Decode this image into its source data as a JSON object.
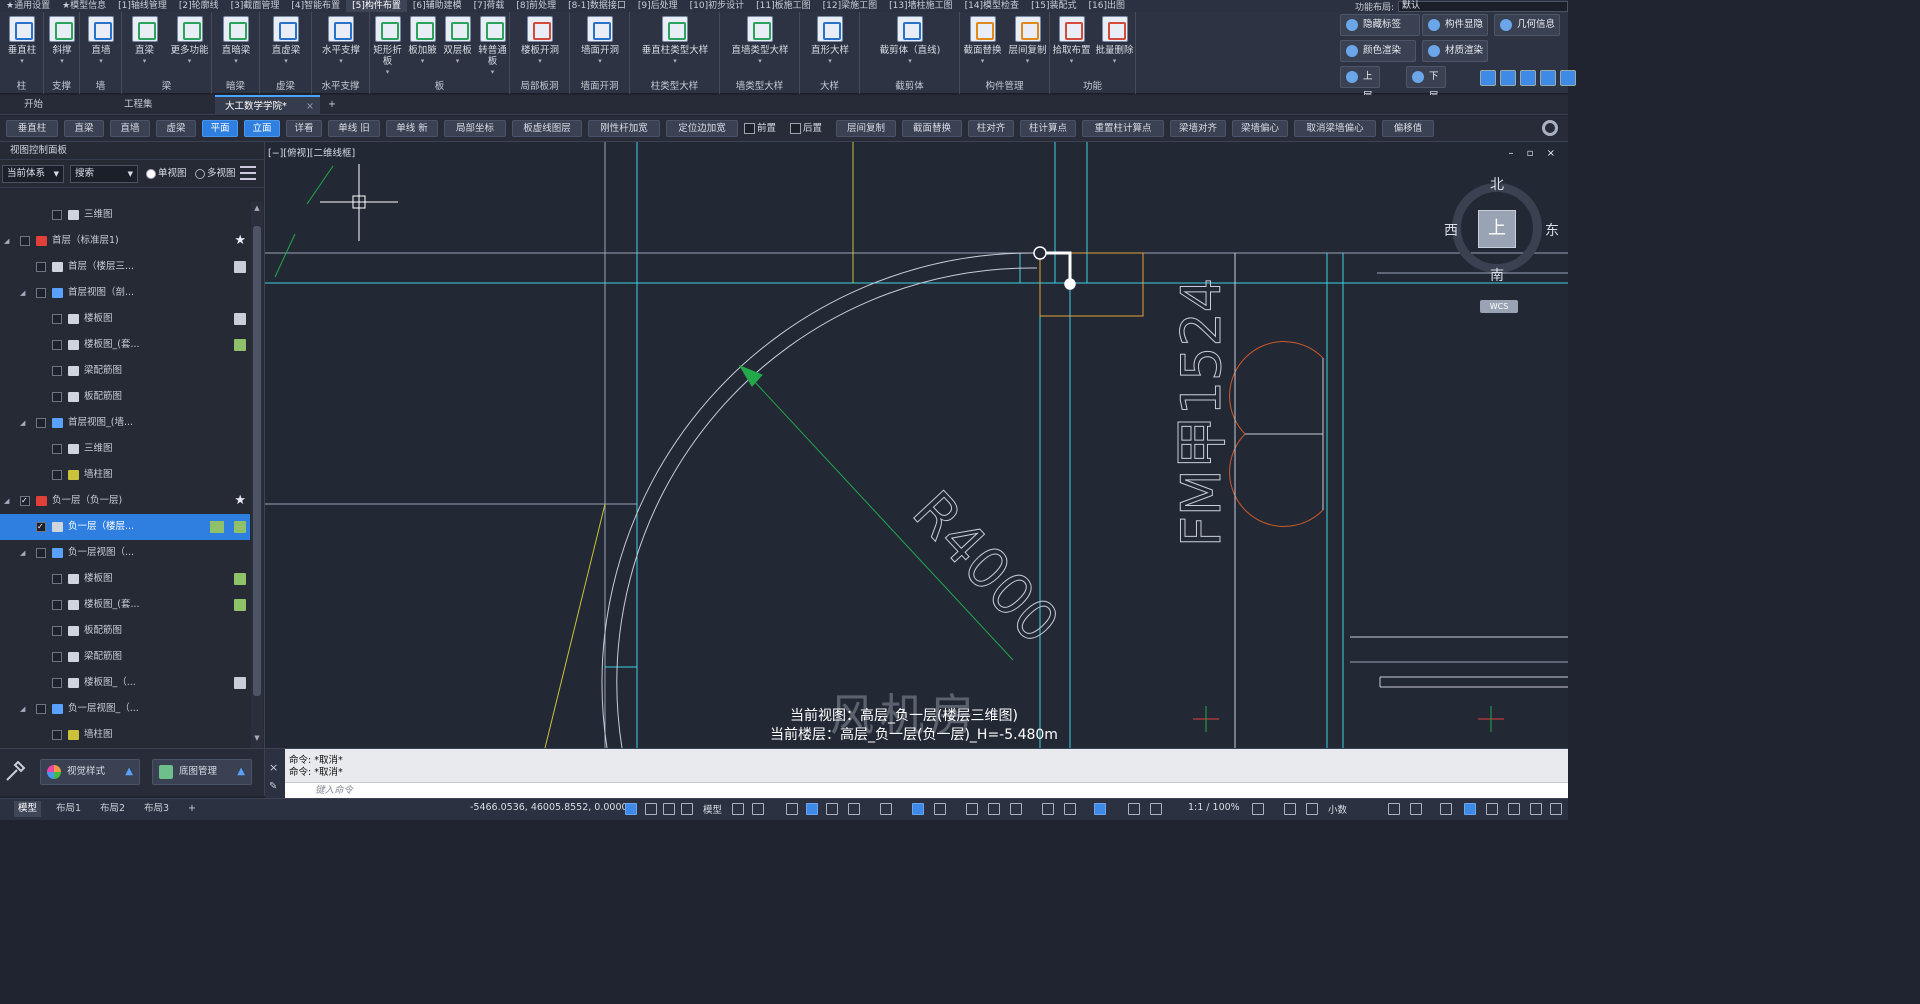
{
  "menubar": {
    "items": [
      "★通用设置",
      "★模型信息",
      "[1]轴线管理",
      "[2]轮廓线",
      "[3]截面管理",
      "[4]智能布置",
      "[5]构件布置",
      "[6]辅助建模",
      "[7]荷载",
      "[8]前处理",
      "[8-1]数据接口",
      "[9]后处理",
      "[10]初步设计",
      "[11]板施工图",
      "[12]梁施工图",
      "[13]墙柱施工图",
      "[14]模型检查",
      "[15]装配式",
      "[16]出图"
    ],
    "active_index": 6,
    "func_layout_label": "功能布局:",
    "func_layout_value": "默认"
  },
  "ribbon": {
    "groups": [
      {
        "label": "柱",
        "buttons": [
          "垂直柱"
        ]
      },
      {
        "label": "支撑",
        "buttons": [
          "斜撑"
        ]
      },
      {
        "label": "墙",
        "buttons": [
          "直墙"
        ]
      },
      {
        "label": "梁",
        "buttons": [
          "直梁",
          "更多功能"
        ]
      },
      {
        "label": "暗梁",
        "buttons": [
          "直暗梁"
        ]
      },
      {
        "label": "虚梁",
        "buttons": [
          "直虚梁"
        ]
      },
      {
        "label": "水平支撑",
        "buttons": [
          "水平支撑"
        ]
      },
      {
        "label": "板",
        "buttons": [
          "矩形折板",
          "板加腋",
          "双层板",
          "转普通板"
        ]
      },
      {
        "label": "局部板洞",
        "buttons": [
          "楼板开洞"
        ]
      },
      {
        "label": "墙面开洞",
        "buttons": [
          "墙面开洞"
        ]
      },
      {
        "label": "柱类型大样",
        "buttons": [
          "垂直柱类型大样"
        ]
      },
      {
        "label": "墙类型大样",
        "buttons": [
          "直墙类型大样"
        ]
      },
      {
        "label": "大样",
        "buttons": [
          "直形大样"
        ]
      },
      {
        "label": "截剪体",
        "buttons": [
          "截剪体（直线)"
        ]
      },
      {
        "label": "构件管理",
        "buttons": [
          "截面替换",
          "层间复制"
        ]
      },
      {
        "label": "功能",
        "buttons": [
          "拾取布置",
          "批量删除"
        ]
      }
    ],
    "right_buttons": [
      "隐藏标签",
      "构件显隐",
      "几何信息",
      "颜色渲染",
      "材质渲染",
      "上层",
      "下层"
    ]
  },
  "tabs": {
    "items": [
      "开始",
      "工程集",
      "大工数学学院*"
    ],
    "active_index": 2,
    "add": "+",
    "close": "×"
  },
  "toolbar": {
    "buttons": [
      "垂直柱",
      "直梁",
      "直墙",
      "虚梁",
      "平面",
      "立面",
      "详看",
      "单线 旧",
      "单线 新",
      "局部坐标",
      "板虚线图层",
      "刚性杆加宽",
      "定位边加宽"
    ],
    "active": [
      "平面",
      "立面"
    ],
    "checks": [
      "前置",
      "后置"
    ],
    "buttons2": [
      "层间复制",
      "截面替换",
      "柱对齐",
      "柱计算点",
      "重置柱计算点",
      "梁墙对齐",
      "梁墙偏心",
      "取消梁墙偏心",
      "偏移值"
    ]
  },
  "panel": {
    "title": "视图控制面板",
    "system_select": "当前体系",
    "search_select": "搜索",
    "single_view": "单视图",
    "multi_view": "多视图",
    "tree": [
      {
        "level": 3,
        "label": "三维图",
        "icon": "cube",
        "expanded": null,
        "checked": false,
        "marker": ""
      },
      {
        "level": 1,
        "label": "首层（标准层1)",
        "icon": "floor",
        "expanded": true,
        "checked": false,
        "marker": "star"
      },
      {
        "level": 2,
        "label": "首层（楼层三...",
        "icon": "table",
        "expanded": null,
        "checked": false,
        "marker": "doc"
      },
      {
        "level": 2,
        "label": "首层视图（剖...",
        "icon": "grid",
        "expanded": true,
        "checked": false,
        "marker": ""
      },
      {
        "level": 3,
        "label": "楼板图",
        "icon": "plan",
        "expanded": null,
        "checked": false,
        "marker": "doc"
      },
      {
        "level": 3,
        "label": "楼板图_(套...",
        "icon": "plan",
        "expanded": null,
        "checked": false,
        "marker": "docg"
      },
      {
        "level": 3,
        "label": "梁配筋图",
        "icon": "plan",
        "expanded": null,
        "checked": false,
        "marker": ""
      },
      {
        "level": 3,
        "label": "板配筋图",
        "icon": "plan",
        "expanded": null,
        "checked": false,
        "marker": ""
      },
      {
        "level": 2,
        "label": "首层视图_(墙...",
        "icon": "grid",
        "expanded": true,
        "checked": false,
        "marker": ""
      },
      {
        "level": 3,
        "label": "三维图",
        "icon": "cube",
        "expanded": null,
        "checked": false,
        "marker": ""
      },
      {
        "level": 3,
        "label": "墙柱图",
        "icon": "wall",
        "expanded": null,
        "checked": false,
        "marker": ""
      },
      {
        "level": 1,
        "label": "负一层（负一层)",
        "icon": "floor",
        "expanded": true,
        "checked": true,
        "marker": "star"
      },
      {
        "level": 2,
        "label": "负一层（楼层...",
        "icon": "table",
        "expanded": null,
        "checked": true,
        "marker": "grid2",
        "selected": true
      },
      {
        "level": 2,
        "label": "负一层视图（...",
        "icon": "grid",
        "expanded": true,
        "checked": false,
        "marker": ""
      },
      {
        "level": 3,
        "label": "楼板图",
        "icon": "plan",
        "expanded": null,
        "checked": false,
        "marker": "docg"
      },
      {
        "level": 3,
        "label": "楼板图_(套...",
        "icon": "plan",
        "expanded": null,
        "checked": false,
        "marker": "docg"
      },
      {
        "level": 3,
        "label": "板配筋图",
        "icon": "plan",
        "expanded": null,
        "checked": false,
        "marker": ""
      },
      {
        "level": 3,
        "label": "梁配筋图",
        "icon": "plan",
        "expanded": null,
        "checked": false,
        "marker": ""
      },
      {
        "level": 3,
        "label": "楼板图_（...",
        "icon": "plan",
        "expanded": null,
        "checked": false,
        "marker": "doc"
      },
      {
        "level": 2,
        "label": "负一层视图_（...",
        "icon": "grid",
        "expanded": true,
        "checked": false,
        "marker": ""
      },
      {
        "level": 3,
        "label": "墙柱图",
        "icon": "wall",
        "expanded": null,
        "checked": false,
        "marker": ""
      }
    ],
    "bottom_buttons": [
      "视觉样式",
      "底图管理"
    ]
  },
  "viewport": {
    "label": "[−][俯视][二维线框]",
    "controls": "– ▫ ×",
    "compass": {
      "north": "北",
      "south": "南",
      "east": "东",
      "west": "西",
      "top": "上",
      "wcs": "WCS"
    },
    "annotations": {
      "radius": "R4000",
      "door": "FM甲1524"
    },
    "status_line1": "当前视图：高层_负一层(楼层三维图)",
    "status_line2": "当前楼层：高层_负一层(负一层)_H=-5.480m",
    "watermark": "风机房"
  },
  "command": {
    "lines": [
      "命令: *取消*",
      "命令: *取消*"
    ],
    "placeholder": "键入命令"
  },
  "statusbar": {
    "tabs": [
      "模型",
      "布局1",
      "布局2",
      "布局3",
      "+"
    ],
    "active_tab": 0,
    "coords": "-5466.0536, 46005.8552, 0.0000",
    "model_label": "模型",
    "scale": "1:1 / 100%",
    "units": "小数"
  },
  "colors": {
    "accent": "#2f7fe0",
    "background": "#232835",
    "cyan": "#3fd0e0",
    "yellow": "#c9c23a",
    "green": "#23a84a"
  }
}
